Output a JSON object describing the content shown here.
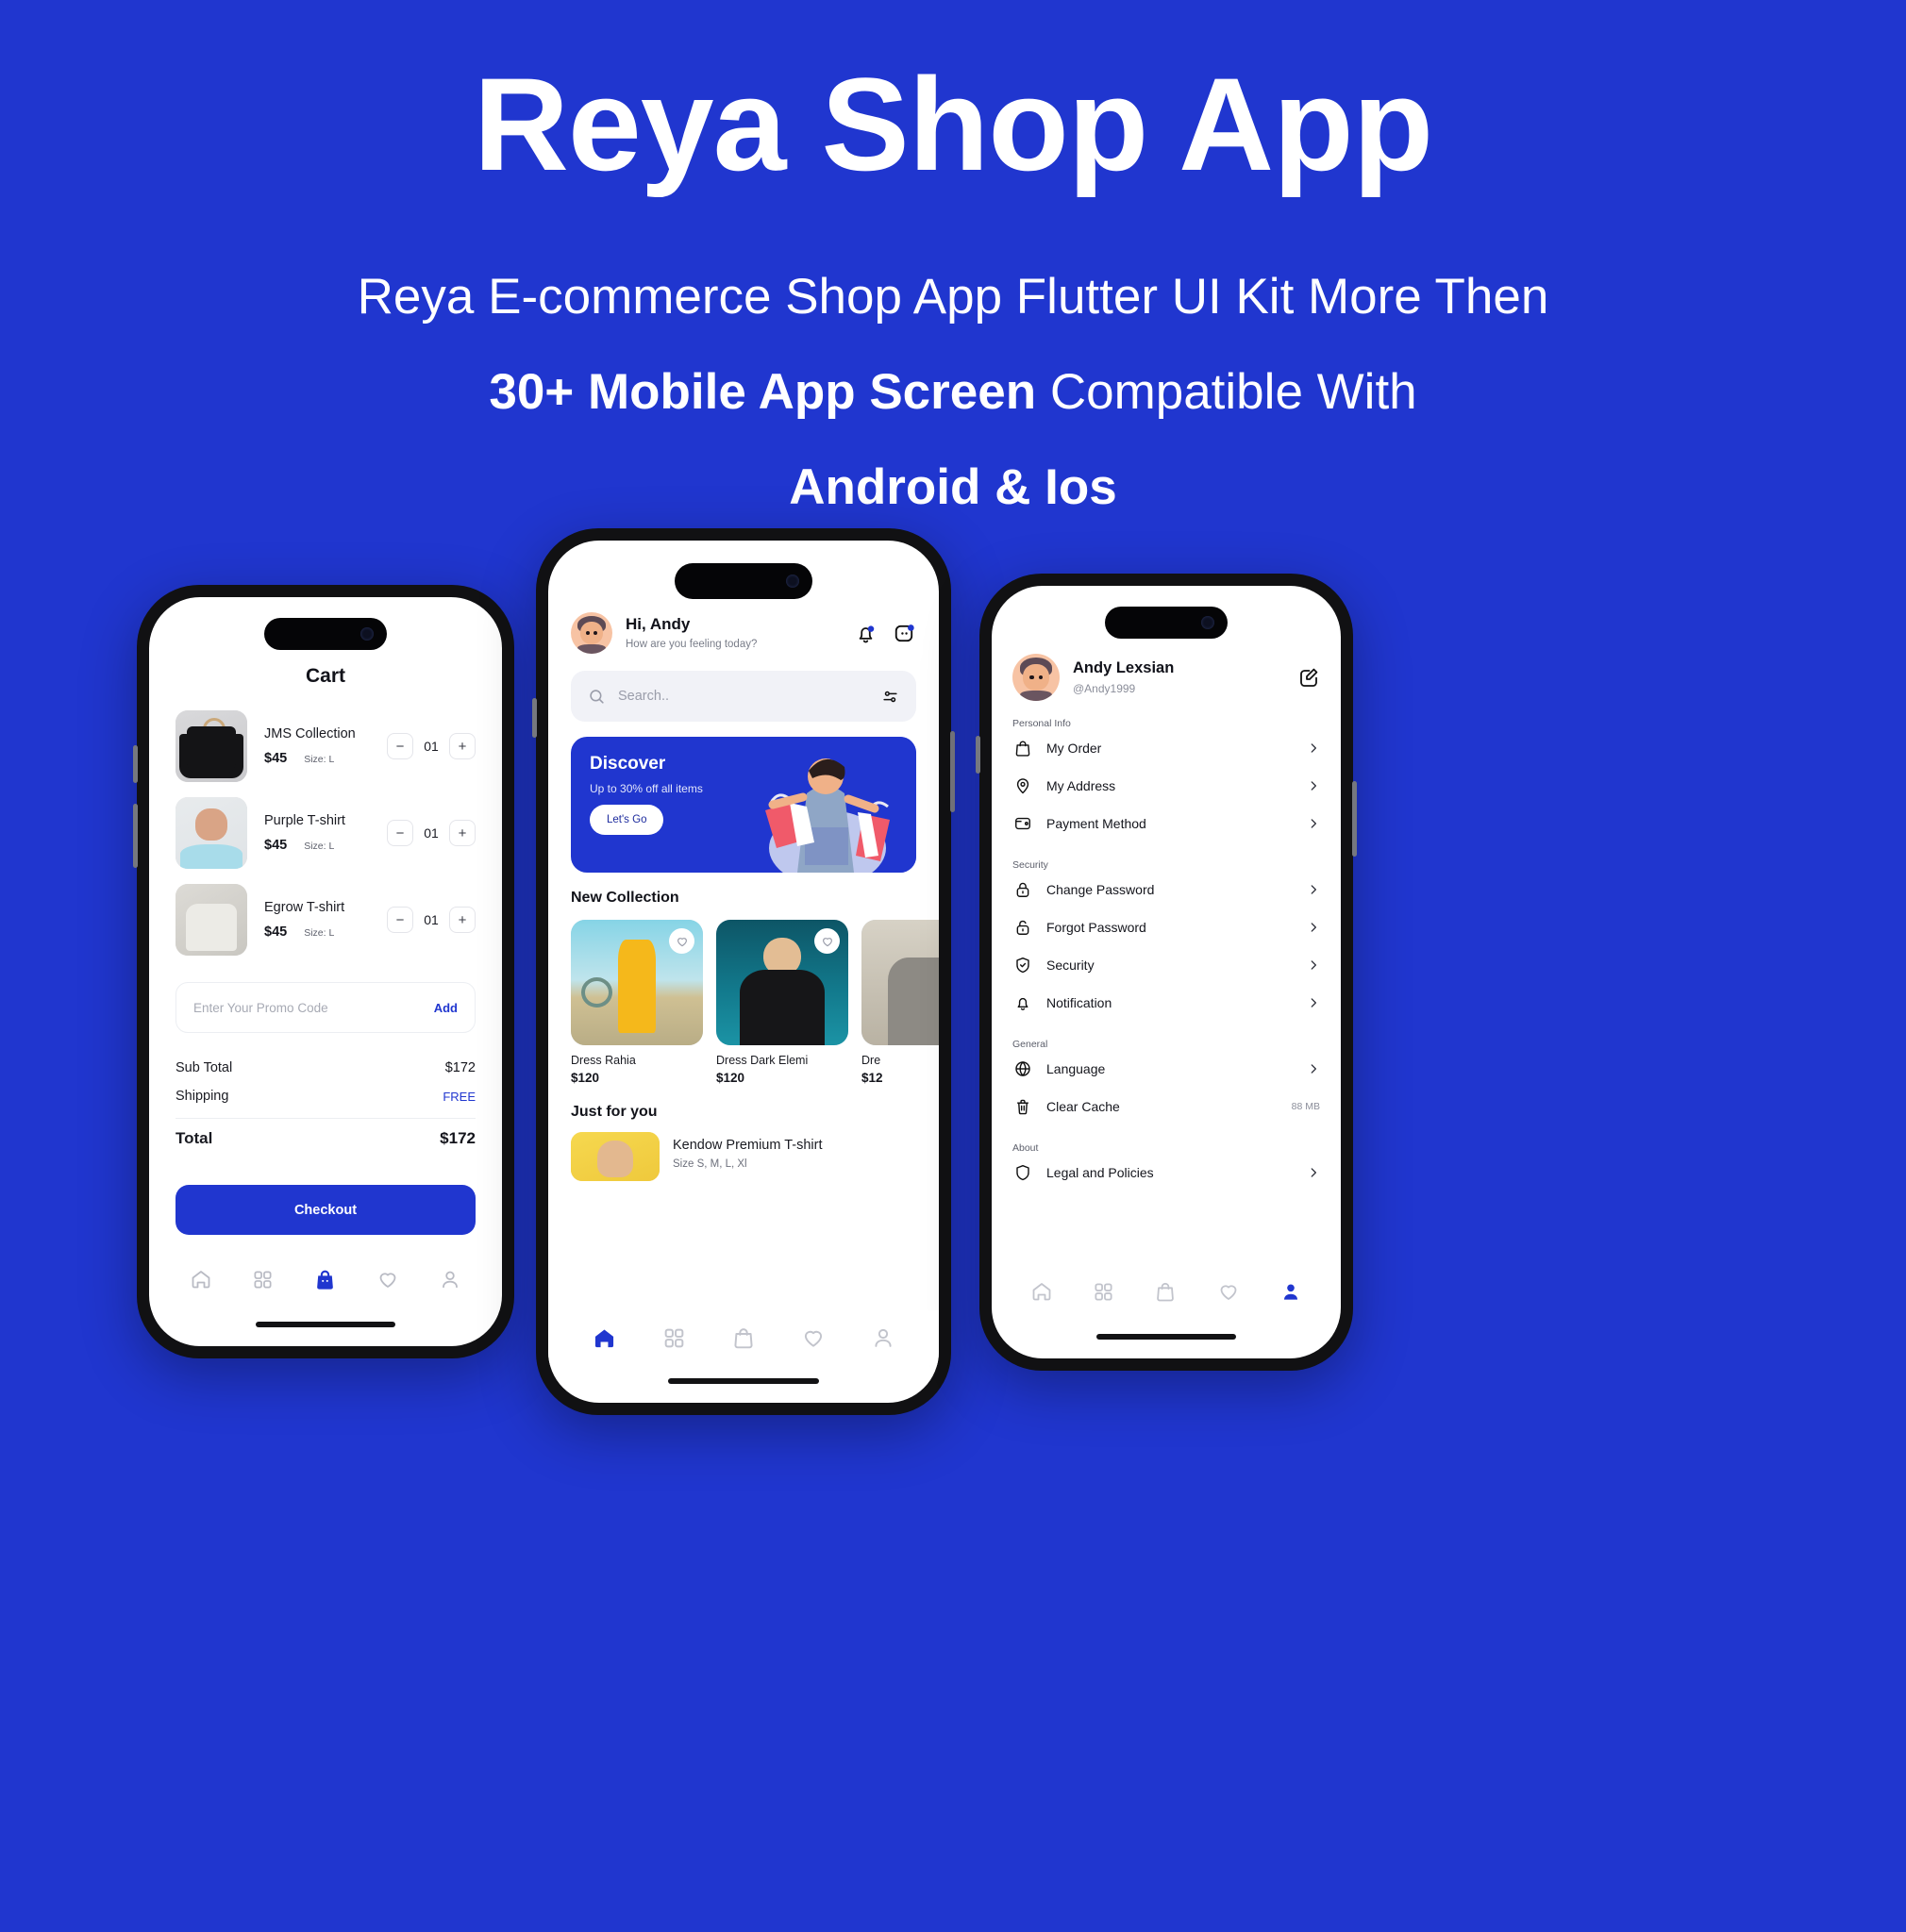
{
  "hero": {
    "title": "Reya Shop App",
    "line1": "Reya E-commerce Shop App Flutter UI Kit More Then",
    "line2_bold": "30+ Mobile App Screen",
    "line2_rest": " Compatible With",
    "line3": "Android & Ios",
    "bg_color": "#2036cf",
    "text_color": "#ffffff"
  },
  "cart_screen": {
    "title": "Cart",
    "items": [
      {
        "name": "JMS Collection",
        "price": "$45",
        "size": "Size: L",
        "qty": "01",
        "minus": "−",
        "plus": "+"
      },
      {
        "name": "Purple T-shirt",
        "price": "$45",
        "size": "Size: L",
        "qty": "01",
        "minus": "−",
        "plus": "+"
      },
      {
        "name": "Egrow T-shirt",
        "price": "$45",
        "size": "Size: L",
        "qty": "01",
        "minus": "−",
        "plus": "+"
      }
    ],
    "promo": {
      "placeholder": "Enter Your Promo Code",
      "add_label": "Add"
    },
    "totals": {
      "subtotal_label": "Sub Total",
      "subtotal_value": "$172",
      "shipping_label": "Shipping",
      "shipping_value": "FREE",
      "total_label": "Total",
      "total_value": "$172"
    },
    "checkout_label": "Checkout",
    "tabs": [
      "home-icon",
      "grid-icon",
      "bag-icon",
      "heart-icon",
      "person-icon"
    ],
    "active_tab": "bag-icon"
  },
  "home_screen": {
    "greeting_name": "Hi, Andy",
    "greeting_sub": "How are you feeling today?",
    "search_placeholder": "Search..",
    "banner": {
      "title": "Discover",
      "subtitle": "Up to 30% off all items",
      "cta": "Let's Go"
    },
    "new_collection_title": "New Collection",
    "products": [
      {
        "name": "Dress Rahia",
        "price": "$120"
      },
      {
        "name": "Dress Dark Elemi",
        "price": "$120"
      },
      {
        "name": "Dre",
        "price": "$12"
      }
    ],
    "just_for_you_title": "Just for you",
    "jfy_item": {
      "name": "Kendow Premium T-shirt",
      "sub": "Size S, M, L, Xl"
    },
    "tabs": [
      "home-icon",
      "grid-icon",
      "bag-icon",
      "heart-icon",
      "person-icon"
    ],
    "active_tab": "home-icon"
  },
  "profile_screen": {
    "name": "Andy Lexsian",
    "handle": "@Andy1999",
    "edit_icon": "edit-icon",
    "groups": [
      {
        "label": "Personal Info",
        "items": [
          {
            "icon": "bag-icon",
            "label": "My Order",
            "value": ""
          },
          {
            "icon": "location-pin-icon",
            "label": "My Address",
            "value": ""
          },
          {
            "icon": "wallet-icon",
            "label": "Payment Method",
            "value": ""
          }
        ]
      },
      {
        "label": "Security",
        "items": [
          {
            "icon": "lock-closed-icon",
            "label": "Change Password",
            "value": ""
          },
          {
            "icon": "lock-open-icon",
            "label": "Forgot Password",
            "value": ""
          },
          {
            "icon": "shield-check-icon",
            "label": "Security",
            "value": ""
          },
          {
            "icon": "bell-icon",
            "label": "Notification",
            "value": ""
          }
        ]
      },
      {
        "label": "General",
        "items": [
          {
            "icon": "globe-icon",
            "label": "Language",
            "value": ""
          },
          {
            "icon": "trash-icon",
            "label": "Clear Cache",
            "value": "88 MB"
          }
        ]
      },
      {
        "label": "About",
        "items": [
          {
            "icon": "shield-icon",
            "label": "Legal and Policies",
            "value": ""
          }
        ]
      }
    ],
    "tabs": [
      "home-icon",
      "grid-icon",
      "bag-icon",
      "heart-icon",
      "person-icon"
    ],
    "active_tab": "person-icon"
  },
  "colors": {
    "brand": "#2036cf",
    "text": "#14151c",
    "muted": "#8b8e9a"
  }
}
